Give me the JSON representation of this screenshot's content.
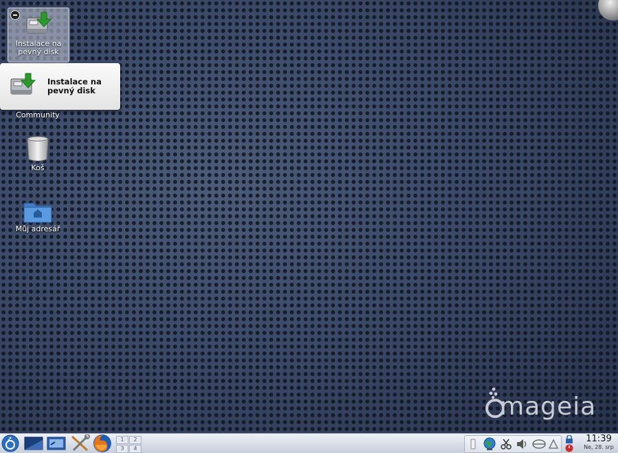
{
  "desktop": {
    "icons": [
      {
        "label": "Instalace na pevný disk",
        "icon": "disk-install-icon"
      },
      {
        "label": "Community",
        "icon": "community-icon"
      },
      {
        "label": "Koš",
        "icon": "trash-icon"
      },
      {
        "label": "Můj adresář",
        "icon": "home-folder-icon"
      }
    ],
    "tooltip": {
      "text": "Instalace na pevný disk"
    },
    "logo": {
      "text": "mageia"
    }
  },
  "taskbar": {
    "launchers": [
      "application-menu-icon",
      "show-desktop-icon",
      "terminal-icon",
      "system-tools-icon",
      "firefox-icon"
    ],
    "pager": [
      "1",
      "2",
      "3",
      "4"
    ],
    "clock": {
      "time": "11:39",
      "date": "Ne, 28. srp"
    }
  },
  "colors": {
    "desktop_bg": "#33415b",
    "taskbar_bg": "#d6dde8",
    "tooltip_bg": "#f2f2f2",
    "logo": "#c9ccd4"
  }
}
